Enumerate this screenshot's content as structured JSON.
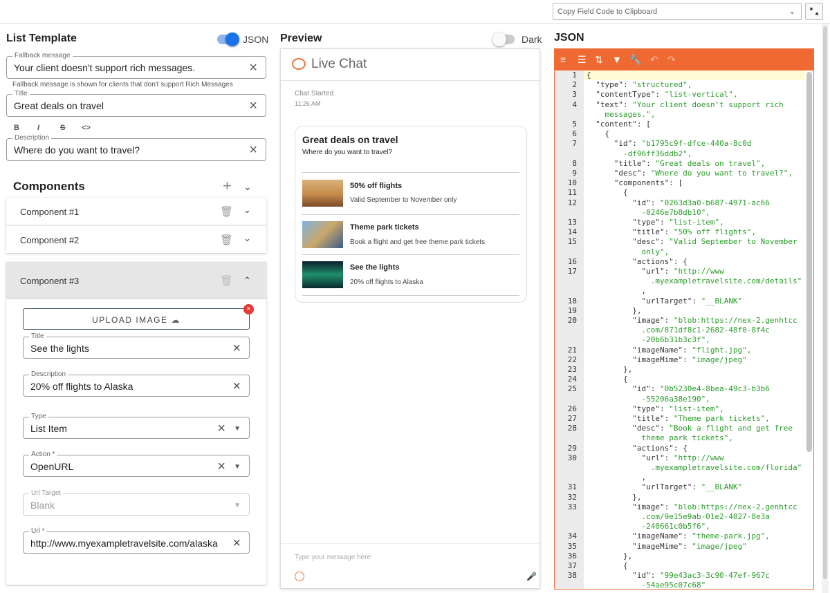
{
  "topbar": {
    "copy_select": "Copy Field Code to Clipboard"
  },
  "left": {
    "title": "List Template",
    "json_toggle_label": "JSON",
    "fallback": {
      "label": "Fallback message",
      "value": "Your client doesn't support rich messages."
    },
    "fallback_helper": "Fallback message is shown for clients that don't support Rich Messages",
    "title_field": {
      "label": "Title",
      "value": "Great deals on travel"
    },
    "format": [
      "B",
      "I",
      "S",
      "<>"
    ],
    "description": {
      "label": "Description",
      "value": "Where do you want to travel?"
    },
    "components_title": "Components",
    "components": [
      "Component #1",
      "Component #2",
      "Component #3"
    ],
    "upload_label": "UPLOAD IMAGE",
    "c3": {
      "title": {
        "label": "Title",
        "value": "See the lights"
      },
      "description": {
        "label": "Description",
        "value": "20% off flights to Alaska"
      },
      "type": {
        "label": "Type",
        "value": "List Item"
      },
      "action": {
        "label": "Action *",
        "value": "OpenURL"
      },
      "url_target": {
        "label": "Url Target",
        "value": "Blank"
      },
      "url": {
        "label": "Url *",
        "value": "http://www.myexampletravelsite.com/alaska"
      }
    }
  },
  "preview": {
    "title": "Preview",
    "dark_label": "Dark",
    "chat_title": "Live Chat",
    "chat_started": "Chat Started",
    "time": "11:26 AM",
    "card_title": "Great deals on travel",
    "card_desc": "Where do you want to travel?",
    "items": [
      {
        "title": "50% off flights",
        "desc": "Valid September to November only"
      },
      {
        "title": "Theme park tickets",
        "desc": "Book a flight and get free theme park tickets"
      },
      {
        "title": "See the lights",
        "desc": "20% off flights to Alaska"
      }
    ],
    "input_placeholder": "Type your message here"
  },
  "json_panel": {
    "title": "JSON",
    "lines": [
      [
        "1",
        "{"
      ],
      [
        "2",
        "  \"type\": \"structured\","
      ],
      [
        "3",
        "  \"contentType\": \"list-vertical\","
      ],
      [
        "4",
        "  \"text\": \"Your client doesn't support rich"
      ],
      [
        "",
        "    messages.\","
      ],
      [
        "5",
        "  \"content\": ["
      ],
      [
        "6",
        "    {"
      ],
      [
        "7",
        "      \"id\": \"b1795c9f-dfce-440a-8c0d"
      ],
      [
        "",
        "        -df96ff36ddb2\","
      ],
      [
        "8",
        "      \"title\": \"Great deals on travel\","
      ],
      [
        "9",
        "      \"desc\": \"Where do you want to travel?\","
      ],
      [
        "10",
        "      \"components\": ["
      ],
      [
        "11",
        "        {"
      ],
      [
        "12",
        "          \"id\": \"0263d3a0-b687-4971-ac66"
      ],
      [
        "",
        "            -0246e7b8db10\","
      ],
      [
        "13",
        "          \"type\": \"list-item\","
      ],
      [
        "14",
        "          \"title\": \"50% off flights\","
      ],
      [
        "15",
        "          \"desc\": \"Valid September to November"
      ],
      [
        "",
        "            only\","
      ],
      [
        "16",
        "          \"actions\": {"
      ],
      [
        "17",
        "            \"url\": \"http://www"
      ],
      [
        "",
        "              .myexampletravelsite.com/details\""
      ],
      [
        "",
        "            ,"
      ],
      [
        "18",
        "            \"urlTarget\": \"__BLANK\""
      ],
      [
        "19",
        "          },"
      ],
      [
        "20",
        "          \"image\": \"blob:https://nex-2.genhtcc"
      ],
      [
        "",
        "            .com/871df8c1-2682-48f0-8f4c"
      ],
      [
        "",
        "            -20b6b31b3c3f\","
      ],
      [
        "21",
        "          \"imageName\": \"flight.jpg\","
      ],
      [
        "22",
        "          \"imageMime\": \"image/jpeg\""
      ],
      [
        "23",
        "        },"
      ],
      [
        "24",
        "        {"
      ],
      [
        "25",
        "          \"id\": \"0b5230e4-8bea-49c3-b3b6"
      ],
      [
        "",
        "            -55206a38e190\","
      ],
      [
        "26",
        "          \"type\": \"list-item\","
      ],
      [
        "27",
        "          \"title\": \"Theme park tickets\","
      ],
      [
        "28",
        "          \"desc\": \"Book a flight and get free"
      ],
      [
        "",
        "            theme park tickets\","
      ],
      [
        "29",
        "          \"actions\": {"
      ],
      [
        "30",
        "            \"url\": \"http://www"
      ],
      [
        "",
        "              .myexampletravelsite.com/florida\""
      ],
      [
        "",
        "            ,"
      ],
      [
        "31",
        "            \"urlTarget\": \"__BLANK\""
      ],
      [
        "32",
        "          },"
      ],
      [
        "33",
        "          \"image\": \"blob:https://nex-2.genhtcc"
      ],
      [
        "",
        "            .com/9e15e9ab-01e2-4027-8e3a"
      ],
      [
        "",
        "            -240661c0b5f6\","
      ],
      [
        "34",
        "          \"imageName\": \"theme-park.jpg\","
      ],
      [
        "35",
        "          \"imageMime\": \"image/jpeg\""
      ],
      [
        "36",
        "        },"
      ],
      [
        "37",
        "        {"
      ],
      [
        "38",
        "          \"id\": \"99e43ac3-3c90-47ef-967c"
      ],
      [
        "",
        "            -54ae95c07c68\""
      ]
    ]
  }
}
